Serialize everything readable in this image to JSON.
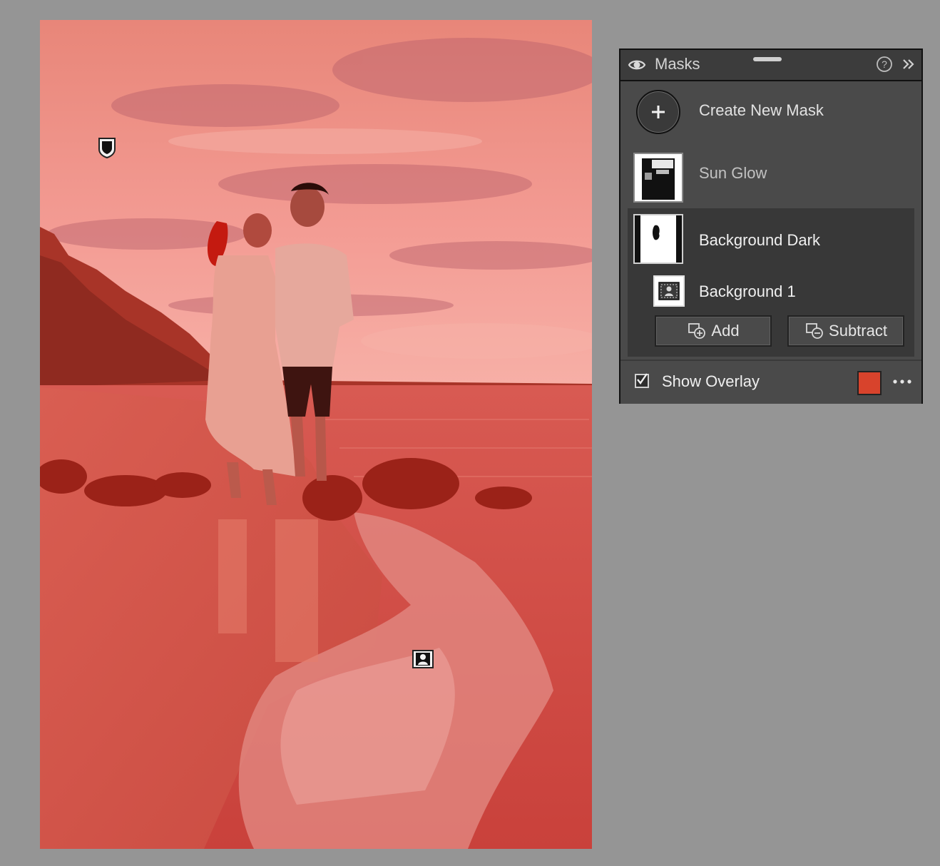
{
  "panel": {
    "title": "Masks",
    "create_label": "Create New Mask",
    "masks": [
      {
        "name": "Sun Glow",
        "selected": false
      },
      {
        "name": "Background Dark",
        "selected": true,
        "components": [
          {
            "name": "Background 1",
            "icon": "portrait-icon"
          }
        ]
      }
    ],
    "add_label": "Add",
    "subtract_label": "Subtract",
    "overlay_label": "Show Overlay",
    "overlay_checked": true,
    "overlay_color": "#d8432c"
  },
  "canvas": {
    "overlay_color": "#d8432c",
    "pins": [
      {
        "icon": "shield-icon"
      },
      {
        "icon": "person-icon"
      }
    ]
  }
}
